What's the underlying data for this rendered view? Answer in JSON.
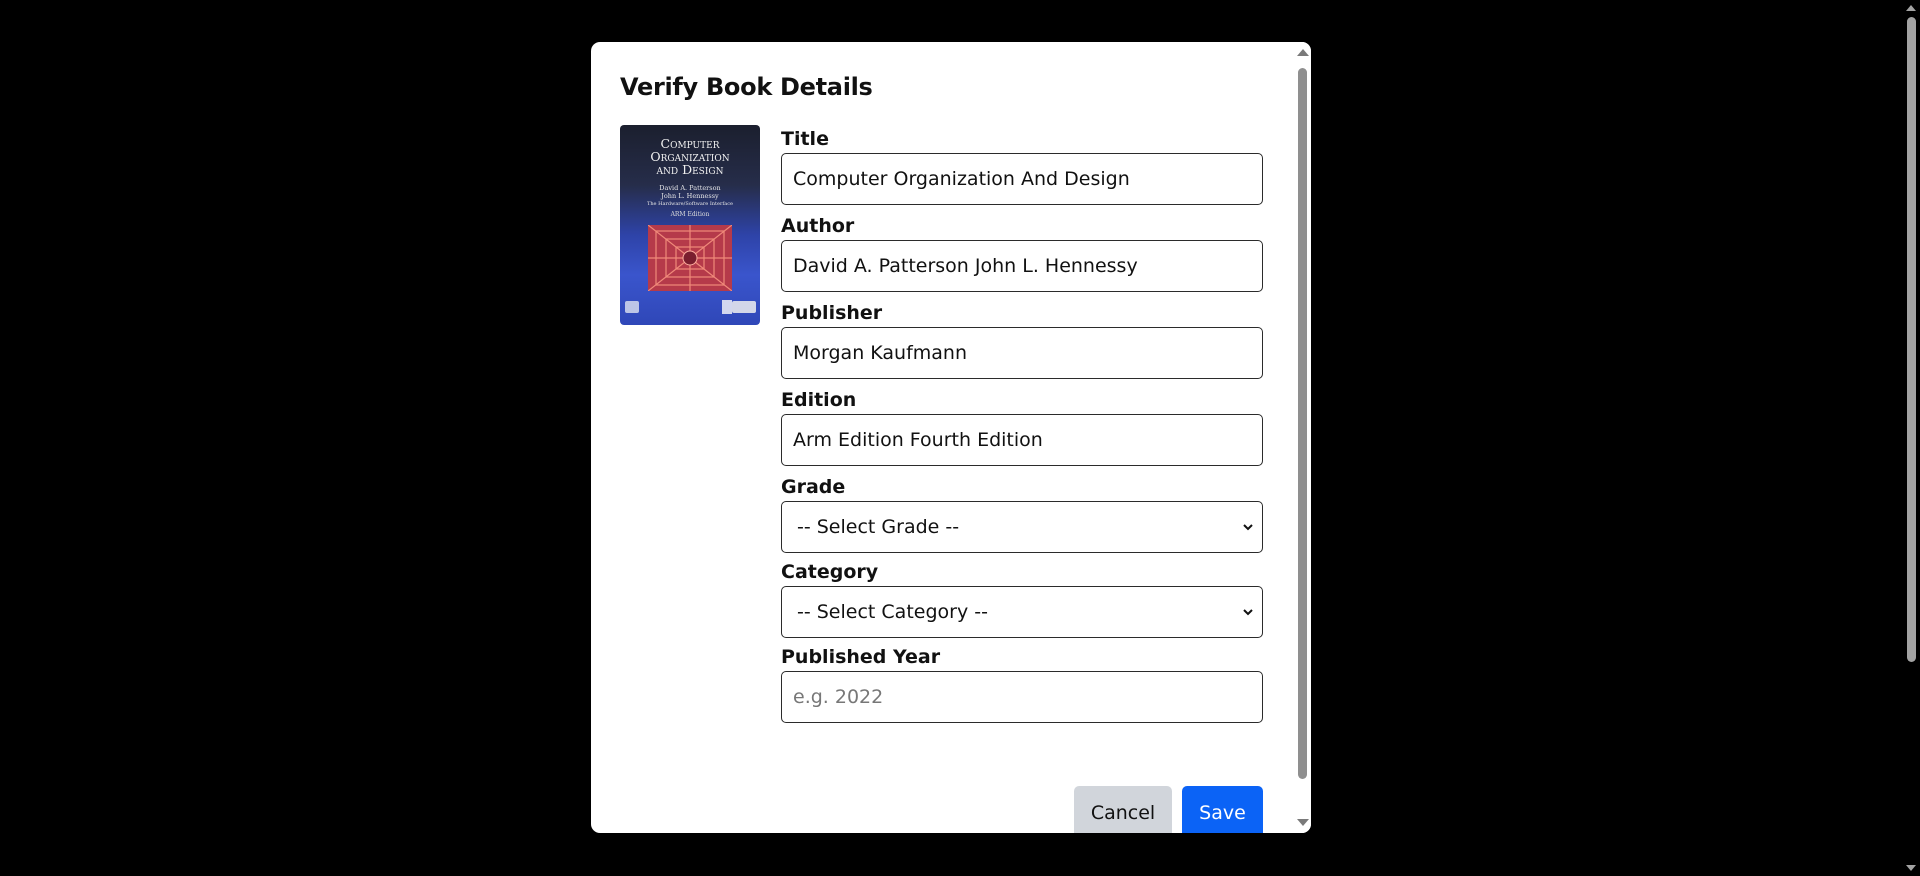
{
  "modal": {
    "title": "Verify Book Details",
    "cover": {
      "title_lines": [
        "Computer",
        "Organization",
        "and Design"
      ],
      "authors": [
        "David A. Patterson",
        "John L. Hennessy"
      ],
      "subtitle": "The Hardware/Software Interface",
      "edition": "ARM Edition"
    },
    "fields": {
      "title": {
        "label": "Title",
        "value": "Computer Organization And Design"
      },
      "author": {
        "label": "Author",
        "value": "David A. Patterson John L. Hennessy"
      },
      "publisher": {
        "label": "Publisher",
        "value": "Morgan Kaufmann"
      },
      "edition": {
        "label": "Edition",
        "value": "Arm Edition Fourth Edition"
      },
      "grade": {
        "label": "Grade",
        "selected": "-- Select Grade --"
      },
      "category": {
        "label": "Category",
        "selected": "-- Select Category --"
      },
      "published_year": {
        "label": "Published Year",
        "placeholder": "e.g. 2022",
        "value": ""
      }
    },
    "buttons": {
      "cancel": "Cancel",
      "save": "Save"
    }
  },
  "colors": {
    "backdrop": "#000000",
    "save_button": "#0b63f6",
    "cancel_button": "#d1d5db"
  },
  "icons": {
    "select_arrow": "chevron-down-icon"
  }
}
